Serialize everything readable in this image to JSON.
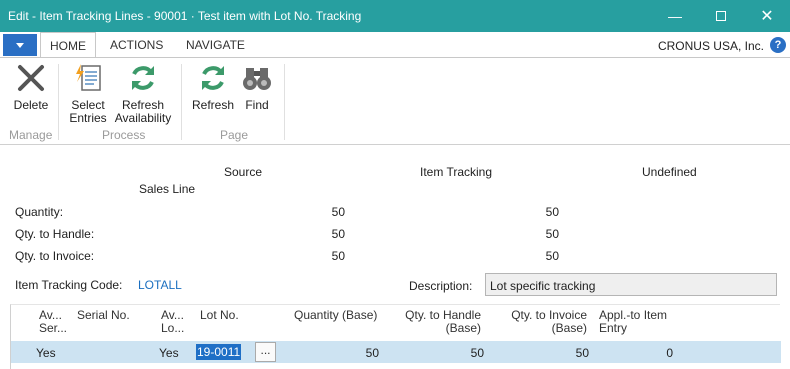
{
  "window": {
    "title": "Edit - Item Tracking Lines - 90001 · Test item with Lot No. Tracking",
    "minimize_glyph": "—",
    "close_glyph": "✕"
  },
  "tabs": {
    "home": "HOME",
    "actions": "ACTIONS",
    "navigate": "NAVIGATE"
  },
  "company": "CRONUS USA, Inc.",
  "help_glyph": "?",
  "ribbon": {
    "delete": "Delete",
    "select_entries": [
      "Select",
      "Entries"
    ],
    "refresh_availability": [
      "Refresh",
      "Availability"
    ],
    "refresh": "Refresh",
    "find": "Find",
    "groups": {
      "manage": "Manage",
      "process": "Process",
      "page": "Page"
    }
  },
  "summary": {
    "col_source": "Source",
    "col_item_tracking": "Item Tracking",
    "col_undefined": "Undefined",
    "source_type": "Sales Line",
    "rows": [
      {
        "label": "Quantity:",
        "source": "50",
        "item_tracking": "50"
      },
      {
        "label": "Qty. to Handle:",
        "source": "50",
        "item_tracking": "50"
      },
      {
        "label": "Qty. to Invoice:",
        "source": "50",
        "item_tracking": "50"
      }
    ],
    "item_tracking_code_label": "Item Tracking Code:",
    "item_tracking_code": "LOTALL",
    "description_label": "Description:",
    "description": "Lot specific tracking"
  },
  "grid": {
    "headers": {
      "avail_serial": [
        "Av...",
        "Ser..."
      ],
      "serial_no": "Serial No.",
      "avail_lot": [
        "Av...",
        "Lo..."
      ],
      "lot_no": "Lot No.",
      "qty_base": "Quantity (Base)",
      "qty_handle": [
        "Qty. to Handle",
        "(Base)"
      ],
      "qty_invoice": [
        "Qty. to Invoice",
        "(Base)"
      ],
      "appl_to": [
        "Appl.-to Item",
        "Entry"
      ]
    },
    "row": {
      "avail_serial": "Yes",
      "avail_lot": "Yes",
      "lot_no": "19-0011",
      "assist": "...",
      "qty_base": "50",
      "qty_handle": "50",
      "qty_invoice": "50",
      "appl_to": "0"
    }
  }
}
